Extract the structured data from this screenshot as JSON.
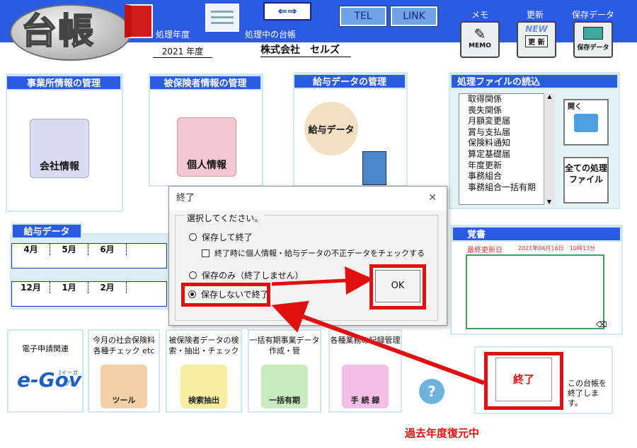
{
  "header": {
    "logo": "台帳",
    "fiscal_year_label": "処理年度",
    "fiscal_year": "2021",
    "fiscal_year_suffix": "年度",
    "current_ledger_label": "処理中の台帳",
    "company_name": "株式会社　セルズ",
    "arrow_button": "⇐⇒",
    "tel_button": "TEL",
    "link_button": "LINK",
    "memo_label": "メモ",
    "memo_icon_text": "MEMO",
    "update_label": "更新",
    "update_new": "NEW",
    "update_icon_text": "更 新",
    "backup_label": "保存データ",
    "backup_icon_text": "保存データ"
  },
  "panels": {
    "office": {
      "title": "事業所情報の管理",
      "button": "会社情報"
    },
    "insured": {
      "title": "被保険者情報の管理",
      "button": "個人情報"
    },
    "salary": {
      "title": "給与データの管理",
      "button": "給与データ"
    }
  },
  "file_reader": {
    "title": "処理ファイルの読込",
    "items": [
      "取得関係",
      "喪失関係",
      "月額変更届",
      "賞与支払届",
      "保険料通知",
      "算定基礎届",
      "年度更新",
      "事務組合",
      "事務組合一括有期"
    ],
    "open_button": "開く",
    "all_files_button": "全ての処理ファイル"
  },
  "memo": {
    "title": "覚書",
    "last_updated_label": "最終更新日",
    "last_updated_value": "2021年04月16日　10時13分"
  },
  "salary_data": {
    "title": "給与データ",
    "row1": [
      "4月",
      "5月",
      "6月"
    ],
    "row2": [
      "12月",
      "1月",
      "2月"
    ]
  },
  "bottom": {
    "egov_title": "電子申請関連",
    "egov_logo": "e-Gov",
    "egov_kana": "[イーガブ]",
    "check_title": "今月の社会保険料各種チェック etc",
    "check_icon": "ツール",
    "search_title": "被保険者データの検索・抽出・チェック",
    "search_icon": "検索抽出",
    "ikkatsu_title": "一括有期事業データ作成・管",
    "ikkatsu_icon": "一括有期",
    "record_title": "各種業務の記録管理",
    "record_icon": "手 続 録",
    "help_icon": "?",
    "exit_button": "終了",
    "exit_note": "この台帳を終了します。",
    "restore_text": "過去年度復元中"
  },
  "dialog": {
    "title": "終了",
    "close": "✕",
    "group_label": "選択してください。",
    "opt_save_exit": "保存して終了",
    "opt_check": "終了時に個人情報・給与データの不正データをチェックする",
    "opt_save_only": "保存のみ（終了しません）",
    "opt_exit_nosave": "保存しないで終了",
    "ok": "OK"
  },
  "colors": {
    "header_blue": "#2b5be0",
    "highlight_red": "#e01010",
    "panel_border": "#cfe8ef"
  }
}
